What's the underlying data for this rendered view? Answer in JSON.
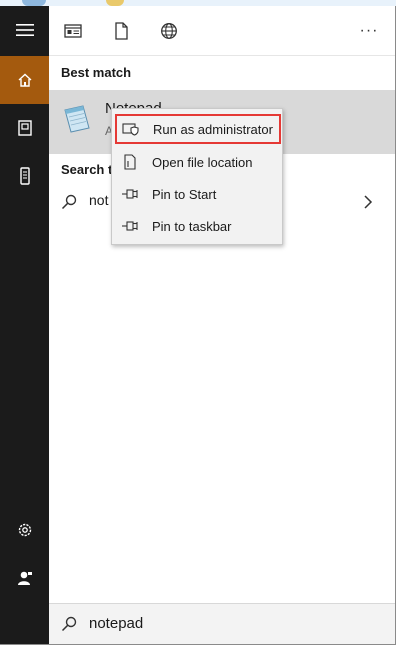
{
  "toolbar": {
    "icons": [
      "apps-icon",
      "documents-icon",
      "web-icon"
    ],
    "more_label": "···"
  },
  "main": {
    "best_match_title": "Best match",
    "best_match": {
      "name": "Notepad",
      "type": "A"
    },
    "search_web_title": "Search th",
    "search_web_query": "not"
  },
  "context_menu": {
    "items": [
      {
        "label": "Run as administrator",
        "icon": "shield-icon",
        "highlighted": true
      },
      {
        "label": "Open file location",
        "icon": "file-location-icon"
      },
      {
        "label": "Pin to Start",
        "icon": "pin-icon"
      },
      {
        "label": "Pin to taskbar",
        "icon": "pin-icon"
      }
    ]
  },
  "search": {
    "query": "notepad"
  },
  "colors": {
    "rail": "#1b1b1b",
    "active_tab": "#a45a0e",
    "highlight_border": "#e53935",
    "selected_row": "#d9d9d9"
  }
}
